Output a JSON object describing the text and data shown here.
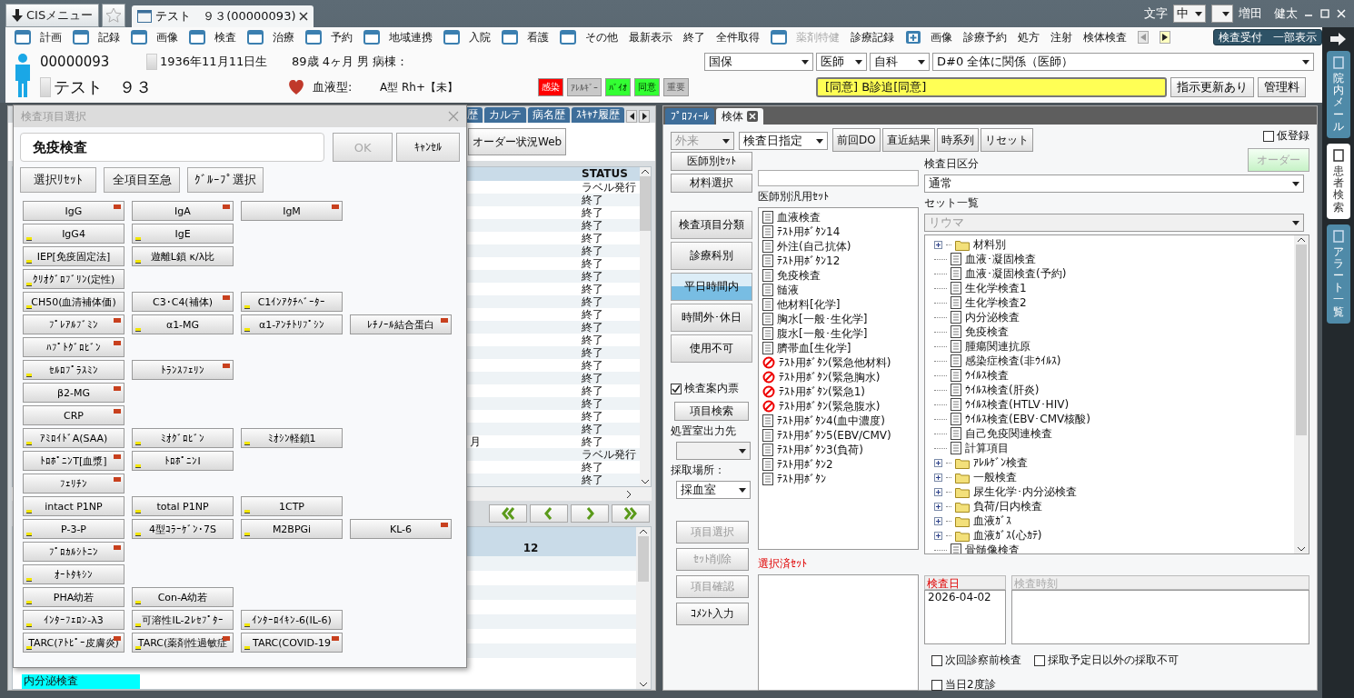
{
  "title_bar": {
    "menu_button": "CISメニュー",
    "patient_tab": "テスト　９３(00000093)",
    "font_label": "文字",
    "font_size": "中",
    "user": "増田　健太"
  },
  "menu": [
    {
      "label": "計画",
      "kind": "window",
      "disabled": false
    },
    {
      "label": "記録",
      "kind": "window",
      "disabled": false
    },
    {
      "label": "画像",
      "kind": "window",
      "disabled": false
    },
    {
      "label": "検査",
      "kind": "window",
      "disabled": false
    },
    {
      "label": "治療",
      "kind": "window",
      "disabled": false
    },
    {
      "label": "予約",
      "kind": "window",
      "disabled": false
    },
    {
      "label": "地域連携",
      "kind": "window",
      "disabled": false
    },
    {
      "label": "入院",
      "kind": "window",
      "disabled": false
    },
    {
      "label": "看護",
      "kind": "window",
      "disabled": false
    },
    {
      "label": "その他",
      "kind": "window",
      "disabled": false
    },
    {
      "label": "最新表示",
      "kind": "plain",
      "disabled": false
    },
    {
      "label": "終了",
      "kind": "plain",
      "disabled": false
    },
    {
      "label": "全件取得",
      "kind": "plain",
      "disabled": false
    },
    {
      "label": "薬剤特健",
      "kind": "window",
      "disabled": true
    },
    {
      "label": "診療記録",
      "kind": "plain",
      "disabled": false
    },
    {
      "label": "画像",
      "kind": "plus",
      "disabled": false
    },
    {
      "label": "診療予約",
      "kind": "plain",
      "disabled": false
    },
    {
      "label": "処方",
      "kind": "plain",
      "disabled": false
    },
    {
      "label": "注射",
      "kind": "plain",
      "disabled": false
    },
    {
      "label": "検体検査",
      "kind": "plain",
      "disabled": false
    }
  ],
  "menu_right_button": "検査受付　一部表示",
  "patient": {
    "id": "00000093",
    "birth": "1936年11月11日生",
    "age": "89歳 4ヶ月",
    "sex_ward": "男 病棟：",
    "name": "テスト　９３",
    "blood_label": "血液型:",
    "blood_type": "A型 Rh+【未】",
    "flags": [
      {
        "label": "感染",
        "color": "#ff0000",
        "kind": "alert"
      },
      {
        "label": "ｱﾚﾙｷﾞｰ",
        "color": "#c8c8c8",
        "kind": "off"
      },
      {
        "label": "ﾊﾞｲｵ",
        "color": "#33ff33",
        "kind": "on"
      },
      {
        "label": "同意",
        "color": "#33ff33",
        "kind": "on"
      },
      {
        "label": "重要",
        "color": "#c8c8c8",
        "kind": "off"
      }
    ],
    "selects": [
      "国保",
      "医師",
      "自科",
      "D#0  全体に関係（医師）"
    ],
    "notice": "[同意] B診追[同意]",
    "buttons": [
      "指示更新あり",
      "管理料"
    ]
  },
  "left_panel": {
    "tabs": [
      "歴",
      "カルテ",
      "病名歴",
      "ｽｷｬﾅ履歴"
    ],
    "order_status_button": "オーダー状況Web",
    "status_header": "STATUS",
    "rows": [
      {
        "status": "ラベル発行"
      },
      {
        "status": "終了"
      },
      {
        "status": "終了"
      },
      {
        "status": "終了"
      },
      {
        "status": "終了"
      },
      {
        "status": "終了"
      },
      {
        "status": "終了"
      },
      {
        "status": "終了"
      },
      {
        "status": "終了"
      },
      {
        "status": "終了"
      },
      {
        "status": "終了"
      },
      {
        "status": "終了"
      },
      {
        "status": "終了"
      },
      {
        "status": "終了"
      },
      {
        "status": "終了"
      },
      {
        "status": "終了"
      },
      {
        "status": "終了"
      },
      {
        "status": "終了"
      },
      {
        "status": "終了"
      },
      {
        "status": "終了"
      },
      {
        "column_1": "月",
        "status": "終了"
      },
      {
        "status": "ラベル発行"
      },
      {
        "status": "終了"
      },
      {
        "status": "終了"
      }
    ],
    "lower_value": "12",
    "bottom_cell": "内分泌検査"
  },
  "dialog": {
    "title": "検査項目選択",
    "group": "免疫検査",
    "ok": "OK",
    "ok_disabled": true,
    "cancel": "ｷｬﾝｾﾙ",
    "actions": [
      "選択ﾘｾｯﾄ",
      "全項目至急",
      "ｸﾞﾙｰﾌﾟ選択"
    ],
    "rows": [
      [
        {
          "label": "IgG",
          "urgent": true,
          "flagged": false
        },
        {
          "label": "IgA",
          "urgent": true,
          "flagged": false
        },
        {
          "label": "IgM",
          "urgent": true,
          "flagged": false
        }
      ],
      [
        {
          "label": "IgG4",
          "urgent": false,
          "flagged": true
        },
        {
          "label": "IgE",
          "urgent": false,
          "flagged": true
        }
      ],
      [
        {
          "label": "IEP[免疫固定法]",
          "urgent": false,
          "flagged": true
        },
        {
          "label": "遊離L鎖 κ/λ比",
          "urgent": false,
          "flagged": true
        }
      ],
      [
        {
          "label": "ｸﾘｵｸﾞﾛﾌﾞﾘﾝ(定性)",
          "urgent": false,
          "flagged": true
        }
      ],
      [
        {
          "label": "CH50(血清補体価)",
          "urgent": false,
          "flagged": true
        },
        {
          "label": "C3･C4(補体)",
          "urgent": true,
          "flagged": false
        },
        {
          "label": "C1ｲﾝｱｸﾁﾍﾞｰﾀｰ",
          "urgent": false,
          "flagged": true
        }
      ],
      [
        {
          "label": "ﾌﾟﾚｱﾙﾌﾞﾐﾝ",
          "urgent": true,
          "flagged": false
        },
        {
          "label": "α1-MG",
          "urgent": false,
          "flagged": true
        },
        {
          "label": "α1-ｱﾝﾁﾄﾘﾌﾟｼﾝ",
          "urgent": false,
          "flagged": true
        },
        {
          "label": "ﾚﾁﾉｰﾙ結合蛋白",
          "urgent": true,
          "flagged": false
        }
      ],
      [
        {
          "label": "ﾊﾌﾟﾄｸﾞﾛﾋﾞﾝ",
          "urgent": true,
          "flagged": false
        }
      ],
      [
        {
          "label": "ｾﾙﾛﾌﾟﾗｽﾐﾝ",
          "urgent": false,
          "flagged": true
        },
        {
          "label": "ﾄﾗﾝｽﾌｪﾘﾝ",
          "urgent": true,
          "flagged": false
        }
      ],
      [
        {
          "label": "β2-MG",
          "urgent": true,
          "flagged": false
        }
      ],
      [
        {
          "label": "CRP",
          "urgent": true,
          "flagged": false
        }
      ],
      [
        {
          "label": "ｱﾐﾛｲﾄﾞA(SAA)",
          "urgent": false,
          "flagged": true
        },
        {
          "label": "ﾐｵｸﾞﾛﾋﾞﾝ",
          "urgent": false,
          "flagged": true
        },
        {
          "label": "ﾐｵｼﾝ軽鎖1",
          "urgent": false,
          "flagged": true
        }
      ],
      [
        {
          "label": "ﾄﾛﾎﾟﾆﾝT[血漿]",
          "urgent": true,
          "flagged": false
        },
        {
          "label": "ﾄﾛﾎﾟﾆﾝI",
          "urgent": false,
          "flagged": true
        }
      ],
      [
        {
          "label": "ﾌｪﾘﾁﾝ",
          "urgent": true,
          "flagged": false
        }
      ],
      [
        {
          "label": "intact P1NP",
          "urgent": false,
          "flagged": true
        },
        {
          "label": "total P1NP",
          "urgent": false,
          "flagged": true
        },
        {
          "label": "1CTP",
          "urgent": false,
          "flagged": true
        }
      ],
      [
        {
          "label": "P-3-P",
          "urgent": false,
          "flagged": true
        },
        {
          "label": "4型ｺﾗｰｹﾞﾝ･7S",
          "urgent": false,
          "flagged": true
        },
        {
          "label": "M2BPGi",
          "urgent": false,
          "flagged": true
        },
        {
          "label": "KL-6",
          "urgent": true,
          "flagged": false
        }
      ],
      [
        {
          "label": "ﾌﾟﾛｶﾙｼﾄﾆﾝ",
          "urgent": true,
          "flagged": false
        }
      ],
      [
        {
          "label": "ｵｰﾄﾀｷｼﾝ",
          "urgent": false,
          "flagged": true
        }
      ],
      [
        {
          "label": "PHA幼若",
          "urgent": false,
          "flagged": true
        },
        {
          "label": "Con-A幼若",
          "urgent": false,
          "flagged": true
        }
      ],
      [
        {
          "label": "ｲﾝﾀｰﾌｪﾛﾝ-λ3",
          "urgent": false,
          "flagged": true
        },
        {
          "label": "可溶性IL-2ﾚｾﾌﾟﾀｰ",
          "urgent": false,
          "flagged": true
        },
        {
          "label": "ｲﾝﾀｰﾛｲｷﾝ-6(IL-6)",
          "urgent": false,
          "flagged": true
        }
      ],
      [
        {
          "label": "TARC(ｱﾄﾋﾟｰ皮膚炎)",
          "urgent": true,
          "flagged": true
        },
        {
          "label": "TARC(薬剤性過敏症",
          "urgent": true,
          "flagged": true
        },
        {
          "label": "TARC(COVID-19",
          "urgent": true,
          "flagged": true
        }
      ]
    ]
  },
  "right_panel": {
    "tabs": [
      {
        "label": "ﾌﾟﾛﾌｨｰﾙ",
        "selected": false
      },
      {
        "label": "検体",
        "selected": true
      }
    ],
    "visit_select": "外来",
    "date_select": "検査日指定",
    "toolbar": [
      "前回DO",
      "直近結果",
      "時系列",
      "リセット"
    ],
    "provisional": {
      "label": "仮登録",
      "checked": false
    },
    "order_button": "オーダー",
    "left_buttons": [
      "医師別ｾｯﾄ",
      "材料選択"
    ],
    "categories": [
      {
        "label": "検査項目分類",
        "selected": false
      },
      {
        "label": "診療科別",
        "selected": false
      },
      {
        "label": "平日時間内",
        "selected": true
      },
      {
        "label": "時間外･休日",
        "selected": false
      },
      {
        "label": "使用不可",
        "selected": false
      }
    ],
    "guide": {
      "label": "検査案内票",
      "checked": true
    },
    "search_button": "項目検索",
    "output_label": "処置室出力先",
    "place_label": "採取場所：",
    "place_select": "採血室",
    "bottom_buttons": [
      {
        "label": "項目選択",
        "disabled": true
      },
      {
        "label": "ｾｯﾄ削除",
        "disabled": true
      },
      {
        "label": "項目確認",
        "disabled": true
      },
      {
        "label": "ｺﾒﾝﾄ入力",
        "disabled": false
      }
    ],
    "doctor_set_label": "医師別汎用ｾｯﾄ",
    "doctor_sets": [
      {
        "label": "血液検査",
        "kind": "doc"
      },
      {
        "label": "ﾃｽﾄ用ﾎﾞﾀﾝ14",
        "kind": "doc"
      },
      {
        "label": "外注(自己抗体)",
        "kind": "doc"
      },
      {
        "label": "ﾃｽﾄ用ﾎﾞﾀﾝ12",
        "kind": "doc"
      },
      {
        "label": "免疫検査",
        "kind": "doc"
      },
      {
        "label": "髄液",
        "kind": "doc"
      },
      {
        "label": "他材料[化学]",
        "kind": "doc"
      },
      {
        "label": "胸水[一般･生化学]",
        "kind": "doc"
      },
      {
        "label": "腹水[一般･生化学]",
        "kind": "doc"
      },
      {
        "label": "臍帯血[生化学]",
        "kind": "doc"
      },
      {
        "label": "ﾃｽﾄ用ﾎﾞﾀﾝ(緊急他材料)",
        "kind": "blocked"
      },
      {
        "label": "ﾃｽﾄ用ﾎﾞﾀﾝ(緊急胸水)",
        "kind": "blocked"
      },
      {
        "label": "ﾃｽﾄ用ﾎﾞﾀﾝ(緊急1)",
        "kind": "blocked"
      },
      {
        "label": "ﾃｽﾄ用ﾎﾞﾀﾝ(緊急腹水)",
        "kind": "blocked"
      },
      {
        "label": "ﾃｽﾄ用ﾎﾞﾀﾝ4(血中濃度)",
        "kind": "doc"
      },
      {
        "label": "ﾃｽﾄ用ﾎﾞﾀﾝ5(EBV/CMV)",
        "kind": "doc"
      },
      {
        "label": "ﾃｽﾄ用ﾎﾞﾀﾝ3(負荷)",
        "kind": "doc"
      },
      {
        "label": "ﾃｽﾄ用ﾎﾞﾀﾝ2",
        "kind": "doc"
      },
      {
        "label": "ﾃｽﾄ用ﾎﾞﾀﾝ",
        "kind": "doc"
      }
    ],
    "selected_set_label": "選択済ｾｯﾄ",
    "date_kind_label": "検査日区分",
    "date_kind": "通常",
    "set_list_label": "セット一覧",
    "set_list_select": "リウマ",
    "tree": [
      {
        "label": "材料別",
        "kind": "folder",
        "expanded": false
      },
      {
        "label": "血液･凝固検査",
        "kind": "doc"
      },
      {
        "label": "血液･凝固検査(予約)",
        "kind": "doc"
      },
      {
        "label": "生化学検査1",
        "kind": "doc"
      },
      {
        "label": "生化学検査2",
        "kind": "doc"
      },
      {
        "label": "内分泌検査",
        "kind": "doc"
      },
      {
        "label": "免疫検査",
        "kind": "doc"
      },
      {
        "label": "腫瘍関連抗原",
        "kind": "doc"
      },
      {
        "label": "感染症検査(非ｳｲﾙｽ)",
        "kind": "doc"
      },
      {
        "label": "ｳｲﾙｽ検査",
        "kind": "doc"
      },
      {
        "label": "ｳｲﾙｽ検査(肝炎)",
        "kind": "doc"
      },
      {
        "label": "ｳｲﾙｽ検査(HTLV･HIV)",
        "kind": "doc"
      },
      {
        "label": "ｳｲﾙｽ検査(EBV･CMV核酸)",
        "kind": "doc"
      },
      {
        "label": "自己免疫関連検査",
        "kind": "doc"
      },
      {
        "label": "計算項目",
        "kind": "doc"
      },
      {
        "label": "ｱﾚﾙｹﾞﾝ検査",
        "kind": "folder",
        "expanded": false
      },
      {
        "label": "一般検査",
        "kind": "folder",
        "expanded": false
      },
      {
        "label": "尿生化学･内分泌検査",
        "kind": "folder",
        "expanded": false
      },
      {
        "label": "負荷/日内検査",
        "kind": "folder",
        "expanded": false
      },
      {
        "label": "血液ｶﾞｽ",
        "kind": "folder",
        "expanded": false
      },
      {
        "label": "血液ｶﾞｽ(心ｶﾃ)",
        "kind": "folder",
        "expanded": false
      },
      {
        "label": "骨髄像検査",
        "kind": "doc"
      }
    ],
    "exam_date_header": "検査日",
    "exam_time_header": "検査時刻",
    "exam_dates": [
      "2026-04-02"
    ],
    "options": [
      {
        "label": "次回診察前検査",
        "checked": false
      },
      {
        "label": "採取予定日以外の採取不可",
        "checked": false
      },
      {
        "label": "当日2度診",
        "checked": false
      }
    ]
  },
  "sidebar": [
    {
      "label": "院内メール",
      "selected": false
    },
    {
      "label": "患者検索",
      "selected": true
    },
    {
      "label": "アラート一覧",
      "selected": false
    }
  ]
}
